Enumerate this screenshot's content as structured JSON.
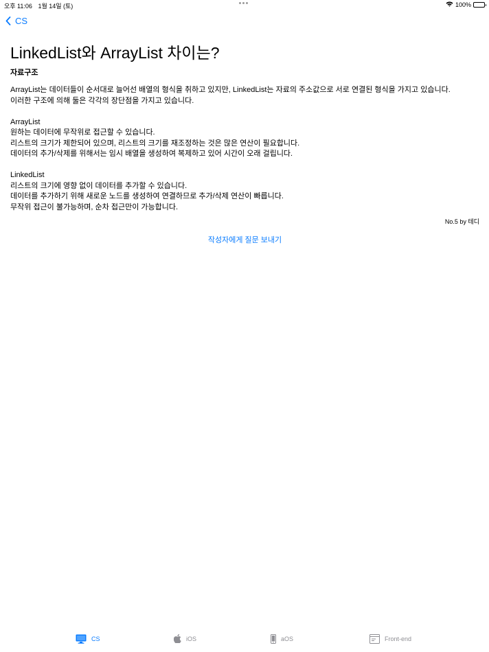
{
  "status_bar": {
    "time": "오후 11:06",
    "date": "1월 14일 (토)",
    "battery": "100%"
  },
  "nav": {
    "back_label": "CS"
  },
  "article": {
    "title": "LinkedList와 ArrayList 차이는?",
    "category": "자료구조",
    "intro_lines": [
      "ArrayList는 데이터들이 순서대로 늘어선 배열의 형식을 취하고 있지만, LinkedList는 자료의 주소값으로 서로 연결된 형식을 가지고 있습니다.",
      "이러한 구조에 의해 둘은 각각의 장단점을 가지고 있습니다."
    ],
    "arraylist": {
      "heading": "ArrayList",
      "lines": [
        "원하는 데이터에 무작위로 접근할 수 있습니다.",
        "리스트의 크기가 제한되어 있으며, 리스트의 크기를 재조정하는 것은 많은 연산이 필요합니다.",
        "데이터의 추가/삭제를 위해서는 임시 배열을 생성하여 복제하고 있어 시간이 오래 걸립니다."
      ]
    },
    "linkedlist": {
      "heading": "LinkedList",
      "lines": [
        "리스트의 크기에 영향 없이 데이터를 추가할 수 있습니다.",
        "데이터를 추가하기 위해 새로운 노드를 생성하여 연결하므로 추가/삭제 연산이 빠릅니다.",
        "무작위 접근이 불가능하며, 순차 접근만이 가능합니다."
      ]
    },
    "author": "No.5 by 테디",
    "ask_link": "작성자에게 질문 보내기"
  },
  "tabs": [
    {
      "label": "CS",
      "icon": "monitor-icon",
      "active": true
    },
    {
      "label": "iOS",
      "icon": "apple-icon",
      "active": false
    },
    {
      "label": "aOS",
      "icon": "phone-icon",
      "active": false
    },
    {
      "label": "Front-end",
      "icon": "browser-icon",
      "active": false
    }
  ],
  "colors": {
    "accent": "#0a7cff",
    "inactive": "#8e8e93"
  }
}
